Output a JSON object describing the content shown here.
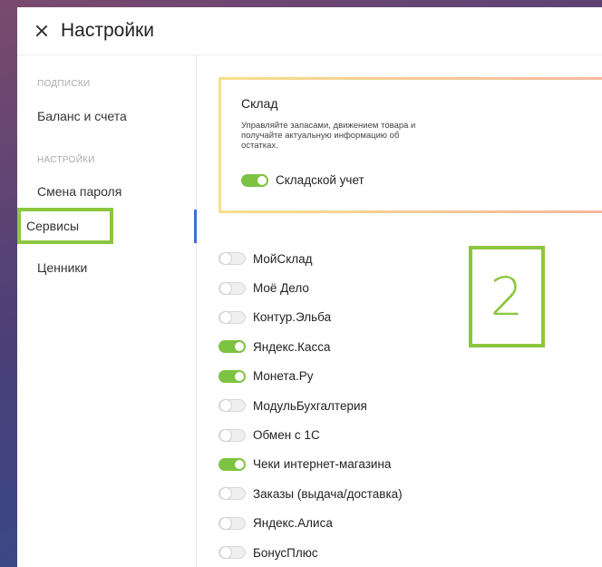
{
  "header": {
    "title": "Настройки"
  },
  "sidebar": {
    "section_subscriptions": "ПОДПИСКИ",
    "balance": "Баланс и счета",
    "section_settings": "НАСТРОЙКИ",
    "change_password": "Смена пароля",
    "services": "Сервисы",
    "price_tags": "Ценники"
  },
  "warehouse_card": {
    "title": "Склад",
    "description": "Управляйте запасами, движением товара и получайте актуальную информацию об остатках.",
    "toggle_label": "Складской учет",
    "toggle_on": true
  },
  "services": [
    {
      "label": "МойСклад",
      "on": false
    },
    {
      "label": "Моё Дело",
      "on": false
    },
    {
      "label": "Контур.Эльба",
      "on": false
    },
    {
      "label": "Яндекс.Касса",
      "on": true
    },
    {
      "label": "Монета.Ру",
      "on": true
    },
    {
      "label": "МодульБухгалтерия",
      "on": false
    },
    {
      "label": "Обмен с 1С",
      "on": false
    },
    {
      "label": "Чеки интернет-магазина",
      "on": true
    },
    {
      "label": "Заказы (выдача/доставка)",
      "on": false
    },
    {
      "label": "Яндекс.Алиса",
      "on": false
    },
    {
      "label": "БонусПлюс",
      "on": false
    }
  ],
  "annotation": {
    "step_number": "2"
  },
  "colors": {
    "toggle_on": "#7ec242",
    "highlight": "#8cc63f",
    "active_indicator": "#3b6fd6"
  }
}
